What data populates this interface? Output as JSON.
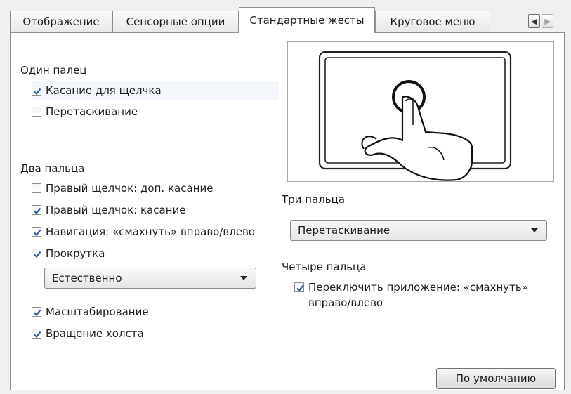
{
  "tabs": [
    {
      "label": "Отображение",
      "active": false
    },
    {
      "label": "Сенсорные опции",
      "active": false
    },
    {
      "label": "Стандартные жесты",
      "active": true
    },
    {
      "label": "Круговое меню",
      "active": false
    }
  ],
  "one_finger": {
    "title": "Один палец",
    "items": [
      {
        "label": "Касание для щелчка",
        "checked": true
      },
      {
        "label": "Перетаскивание",
        "checked": false
      }
    ]
  },
  "two_fingers": {
    "title": "Два пальца",
    "items": [
      {
        "label": "Правый щелчок: доп. касание",
        "checked": false
      },
      {
        "label": "Правый щелчок: касание",
        "checked": true
      },
      {
        "label": "Навигация: «смахнуть» вправо/влево",
        "checked": true
      },
      {
        "label": "Прокрутка",
        "checked": true
      }
    ],
    "scroll_mode": "Естественно",
    "items_after": [
      {
        "label": "Масштабирование",
        "checked": true
      },
      {
        "label": "Вращение холста",
        "checked": true
      }
    ]
  },
  "three_fingers": {
    "title": "Три пальца",
    "selected": "Перетаскивание"
  },
  "four_fingers": {
    "title": "Четыре пальца",
    "item_line1": "Переключить приложение: «смахнуть»",
    "item_line2": "вправо/влево",
    "checked": true
  },
  "default_button": "По умолчанию",
  "colors": {
    "check": "#2c5aa0",
    "panel_bg": "#ffffff",
    "window_bg": "#f0f0f0"
  }
}
